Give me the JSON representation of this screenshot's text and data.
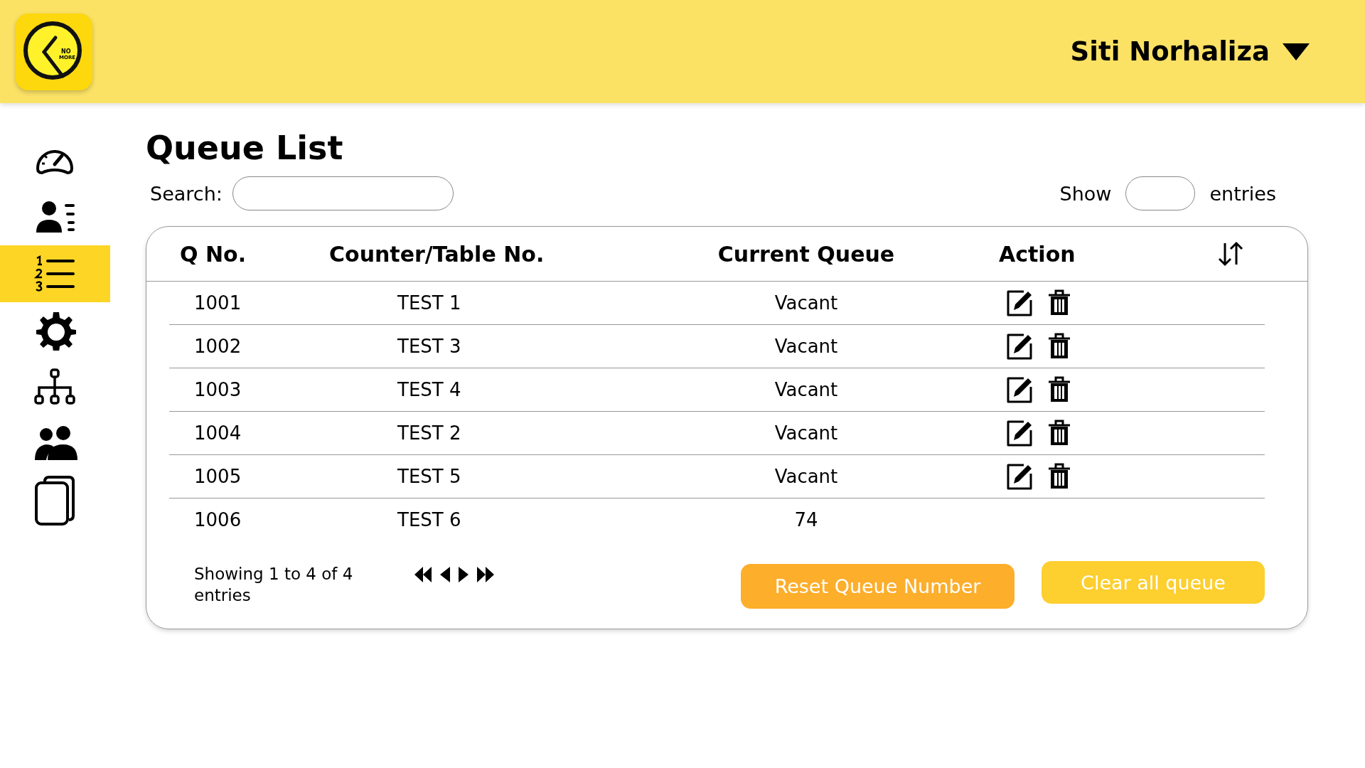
{
  "header": {
    "user_name": "Siti Norhaliza"
  },
  "logo": {
    "text_line_1": "NO",
    "text_line_2": "MORE"
  },
  "sidebar": {
    "items": [
      {
        "kind": "dashboard",
        "selected": false
      },
      {
        "kind": "profile",
        "selected": false
      },
      {
        "kind": "queue",
        "selected": true
      },
      {
        "kind": "settings",
        "selected": false
      },
      {
        "kind": "hierarchy",
        "selected": false
      },
      {
        "kind": "users",
        "selected": false
      },
      {
        "kind": "pages",
        "selected": false
      }
    ]
  },
  "page": {
    "title": "Queue List"
  },
  "search": {
    "label": "Search:"
  },
  "show": {
    "label": "Show",
    "suffix": "entries"
  },
  "table": {
    "columns": [
      "Q No.",
      "Counter/Table No.",
      "Current Queue",
      "Action"
    ],
    "rows": [
      {
        "q_no": "1001",
        "counter": "TEST 1",
        "current": "Vacant",
        "editable": true
      },
      {
        "q_no": "1002",
        "counter": "TEST 3",
        "current": "Vacant",
        "editable": true
      },
      {
        "q_no": "1003",
        "counter": "TEST 4",
        "current": "Vacant",
        "editable": true
      },
      {
        "q_no": "1004",
        "counter": "TEST 2",
        "current": "Vacant",
        "editable": true
      },
      {
        "q_no": "1005",
        "counter": "TEST 5",
        "current": "Vacant",
        "editable": true
      },
      {
        "q_no": "1006",
        "counter": "TEST 6",
        "current": "74",
        "editable": false
      }
    ]
  },
  "footer": {
    "info": "Showing 1 to 4 of 4 entries",
    "buttons": [
      {
        "kind": "reset",
        "label": "Reset Queue Number"
      },
      {
        "kind": "clear",
        "label": "Clear all queue"
      }
    ]
  }
}
